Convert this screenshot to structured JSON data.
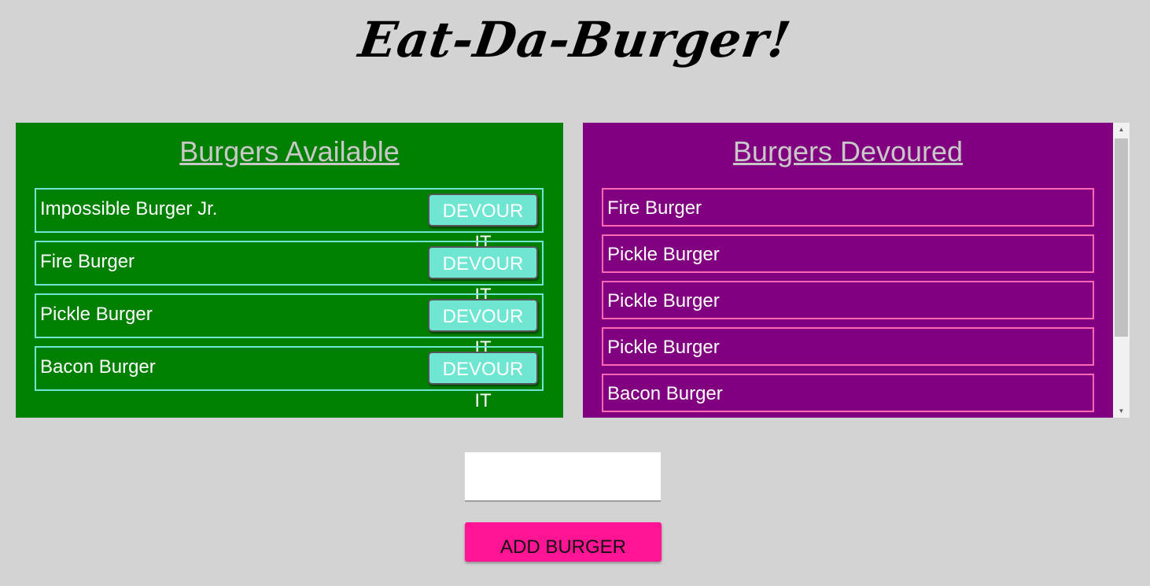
{
  "header": {
    "title": "Eat-Da-Burger!"
  },
  "available": {
    "heading": "Burgers Available",
    "button_label": "DEVOUR IT",
    "items": [
      {
        "name": "Impossible Burger Jr."
      },
      {
        "name": "Fire Burger"
      },
      {
        "name": "Pickle Burger"
      },
      {
        "name": "Bacon Burger"
      }
    ]
  },
  "devoured": {
    "heading": "Burgers Devoured",
    "items": [
      {
        "name": "Fire Burger"
      },
      {
        "name": "Pickle Burger"
      },
      {
        "name": "Pickle Burger"
      },
      {
        "name": "Pickle Burger"
      },
      {
        "name": "Bacon Burger"
      }
    ]
  },
  "form": {
    "input_value": "",
    "submit_label": "ADD BURGER"
  },
  "colors": {
    "background": "#d3d3d3",
    "available_panel": "#008000",
    "devoured_panel": "#800080",
    "devour_button": "#6ee6d2",
    "devoured_border": "#ff69b4",
    "add_button": "#ff1493"
  },
  "icons": {
    "scroll_up": "scroll-up-arrow-icon",
    "scroll_down": "scroll-down-arrow-icon"
  }
}
